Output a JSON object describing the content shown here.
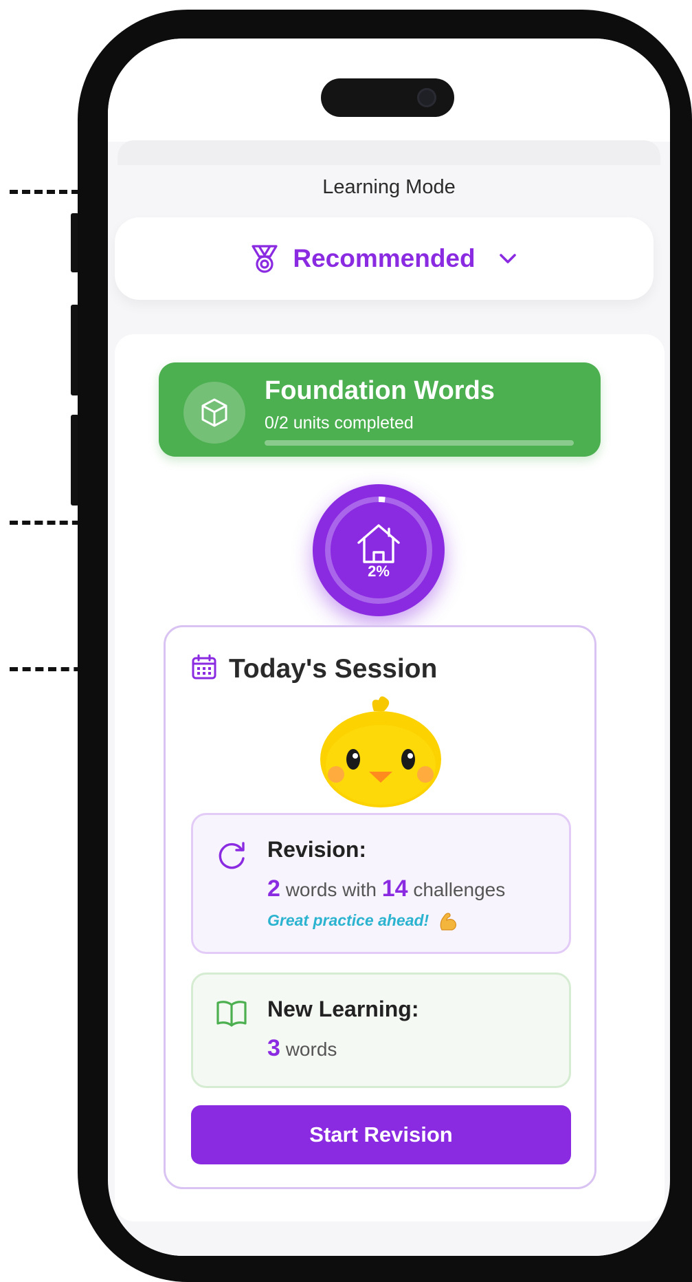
{
  "learning_mode": {
    "label": "Learning Mode",
    "selected": "Recommended",
    "icon": "medal-icon"
  },
  "unit": {
    "title": "Foundation Words",
    "progress_text": "0/2 units completed",
    "progress_fraction": 0,
    "icon": "cube-icon",
    "color": "#4caf50"
  },
  "lesson_node": {
    "icon": "house-icon",
    "percent_label": "2%",
    "progress_fraction": 0.02,
    "color": "#8a2be2"
  },
  "session": {
    "title": "Today's Session",
    "icon": "calendar-icon",
    "revision": {
      "title": "Revision:",
      "words_count": "2",
      "words_text": "words with",
      "challenges_count": "14",
      "challenges_text": "challenges",
      "note": "Great practice ahead!",
      "icon": "refresh-icon"
    },
    "new_learning": {
      "title": "New Learning:",
      "words_count": "3",
      "words_text": "words",
      "icon": "book-icon"
    },
    "start_button": "Start Revision"
  },
  "colors": {
    "accent": "#8a2be2",
    "success": "#4caf50",
    "note": "#2bb3cf"
  }
}
